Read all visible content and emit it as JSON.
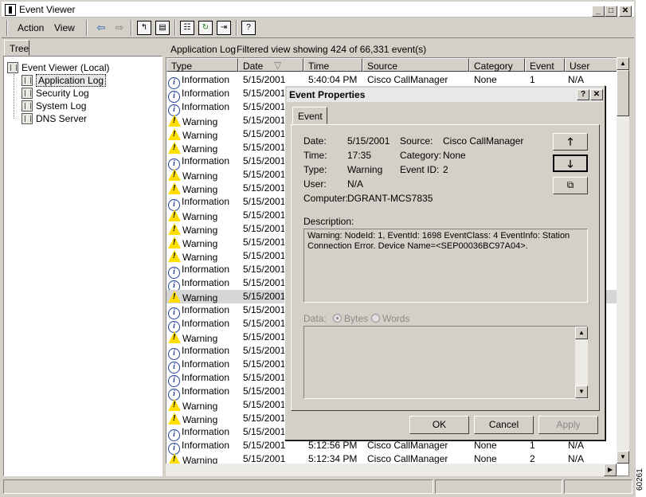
{
  "window": {
    "title": "Event Viewer"
  },
  "menu": {
    "action": "Action",
    "view": "View"
  },
  "left": {
    "tab": "Tree",
    "tree": [
      {
        "label": "Event Viewer (Local)"
      },
      {
        "label": "Application Log",
        "selected": true
      },
      {
        "label": "Security Log"
      },
      {
        "label": "System Log"
      },
      {
        "label": "DNS Server"
      }
    ]
  },
  "right": {
    "title": "Application Log",
    "filter_info": "Filtered view showing 424 of 66,331 event(s)",
    "columns": [
      "Type",
      "Date",
      "Time",
      "Source",
      "Category",
      "Event",
      "User"
    ],
    "rows": [
      {
        "type": "Information",
        "date": "5/15/2001",
        "time": "5:40:04 PM",
        "source": "Cisco CallManager",
        "category": "None",
        "event": "1",
        "user": "N/A"
      },
      {
        "type": "Information",
        "date": "5/15/2001"
      },
      {
        "type": "Information",
        "date": "5/15/2001"
      },
      {
        "type": "Warning",
        "date": "5/15/2001"
      },
      {
        "type": "Warning",
        "date": "5/15/2001"
      },
      {
        "type": "Warning",
        "date": "5/15/2001"
      },
      {
        "type": "Information",
        "date": "5/15/2001"
      },
      {
        "type": "Warning",
        "date": "5/15/2001"
      },
      {
        "type": "Warning",
        "date": "5/15/2001"
      },
      {
        "type": "Information",
        "date": "5/15/2001"
      },
      {
        "type": "Warning",
        "date": "5/15/2001"
      },
      {
        "type": "Warning",
        "date": "5/15/2001"
      },
      {
        "type": "Warning",
        "date": "5/15/2001"
      },
      {
        "type": "Warning",
        "date": "5/15/2001"
      },
      {
        "type": "Information",
        "date": "5/15/2001"
      },
      {
        "type": "Information",
        "date": "5/15/2001"
      },
      {
        "type": "Warning",
        "date": "5/15/2001",
        "selected": true
      },
      {
        "type": "Information",
        "date": "5/15/2001"
      },
      {
        "type": "Information",
        "date": "5/15/2001"
      },
      {
        "type": "Warning",
        "date": "5/15/2001"
      },
      {
        "type": "Information",
        "date": "5/15/2001"
      },
      {
        "type": "Information",
        "date": "5/15/2001"
      },
      {
        "type": "Information",
        "date": "5/15/2001"
      },
      {
        "type": "Information",
        "date": "5/15/2001"
      },
      {
        "type": "Warning",
        "date": "5/15/2001"
      },
      {
        "type": "Warning",
        "date": "5/15/2001"
      },
      {
        "type": "Information",
        "date": "5/15/2001"
      },
      {
        "type": "Information",
        "date": "5/15/2001",
        "time": "5:12:56 PM",
        "source": "Cisco CallManager",
        "category": "None",
        "event": "1",
        "user": "N/A"
      },
      {
        "type": "Warning",
        "date": "5/15/2001",
        "time": "5:12:34 PM",
        "source": "Cisco CallManager",
        "category": "None",
        "event": "2",
        "user": "N/A"
      }
    ]
  },
  "dialog": {
    "title": "Event Properties",
    "tab": "Event",
    "date_label": "Date:",
    "date": "5/15/2001",
    "source_label": "Source:",
    "source": "Cisco CallManager",
    "time_label": "Time:",
    "time": "17:35",
    "category_label": "Category:",
    "category": "None",
    "type_label": "Type:",
    "type": "Warning",
    "eventid_label": "Event ID:",
    "eventid": "2",
    "user_label": "User:",
    "user": "N/A",
    "computer_label": "Computer:",
    "computer": "DGRANT-MCS7835",
    "description_label": "Description:",
    "description": "Warning: NodeId:    1, EventId: 1698 EventClass:  4 EventInfo: Station Connection Error. Device Name=<SEP00036BC97A04>.",
    "data_label": "Data:",
    "bytes_label": "Bytes",
    "words_label": "Words",
    "ok": "OK",
    "cancel": "Cancel",
    "apply": "Apply"
  },
  "figure_id": "60261"
}
